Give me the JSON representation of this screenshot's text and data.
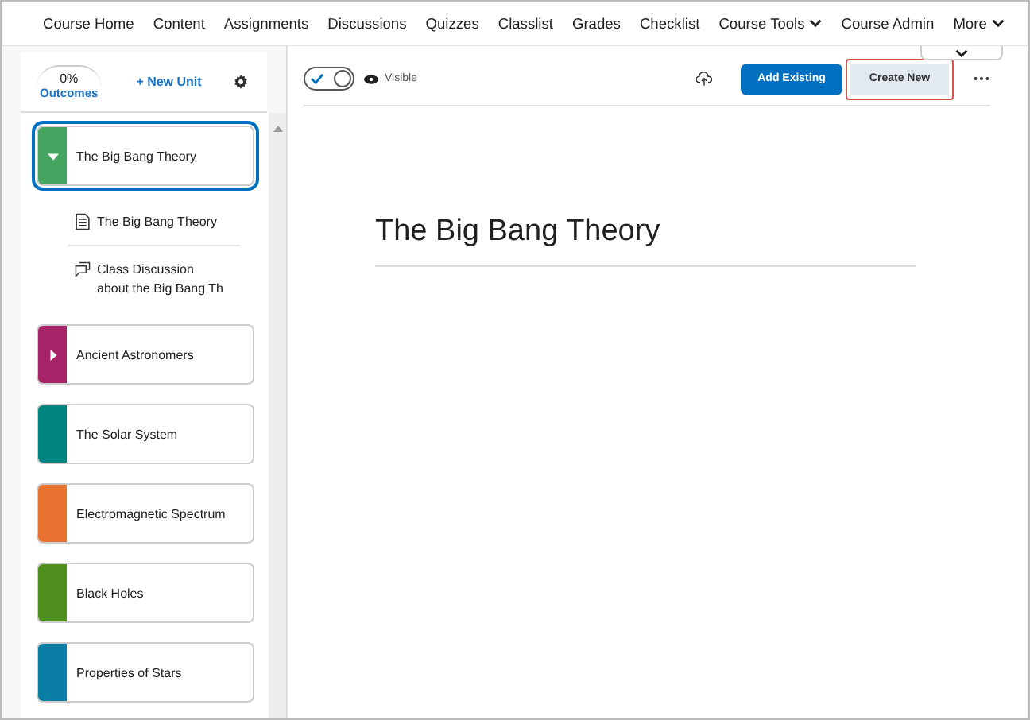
{
  "nav": [
    {
      "label": "Course Home",
      "dropdown": false
    },
    {
      "label": "Content",
      "dropdown": false
    },
    {
      "label": "Assignments",
      "dropdown": false
    },
    {
      "label": "Discussions",
      "dropdown": false
    },
    {
      "label": "Quizzes",
      "dropdown": false
    },
    {
      "label": "Classlist",
      "dropdown": false
    },
    {
      "label": "Grades",
      "dropdown": false
    },
    {
      "label": "Checklist",
      "dropdown": false
    },
    {
      "label": "Course Tools",
      "dropdown": true
    },
    {
      "label": "Course Admin",
      "dropdown": false
    },
    {
      "label": "More",
      "dropdown": true
    }
  ],
  "sidebar": {
    "outcomes_percent": "0%",
    "outcomes_label": "Outcomes",
    "new_unit": "+ New Unit",
    "units": [
      {
        "title": "The Big Bang Theory",
        "color": "#46a661",
        "kind": "group",
        "expanded": true,
        "selected": true,
        "children": [
          {
            "kind": "document",
            "title": "The Big Bang Theory"
          },
          {
            "kind": "discussion",
            "title": "Class Discussion about the Big Bang Th"
          }
        ]
      },
      {
        "title": "Ancient Astronomers",
        "color": "#a82468",
        "kind": "group",
        "expanded": false,
        "selected": false
      },
      {
        "title": "The Solar System",
        "color": "#00847f",
        "kind": "plain",
        "selected": false
      },
      {
        "title": "Electromagnetic Spectrum",
        "color": "#e87330",
        "kind": "plain",
        "selected": false
      },
      {
        "title": "Black Holes",
        "color": "#4e8f1e",
        "kind": "plain",
        "selected": false
      },
      {
        "title": "Properties of Stars",
        "color": "#0a7ea4",
        "kind": "plain",
        "selected": false
      }
    ]
  },
  "toolbar": {
    "visible": true,
    "visible_label": "Visible",
    "add_existing": "Add Existing",
    "create_new": {
      "label": "Create New",
      "highlighted": true
    }
  },
  "main": {
    "title": "The Big Bang Theory"
  }
}
